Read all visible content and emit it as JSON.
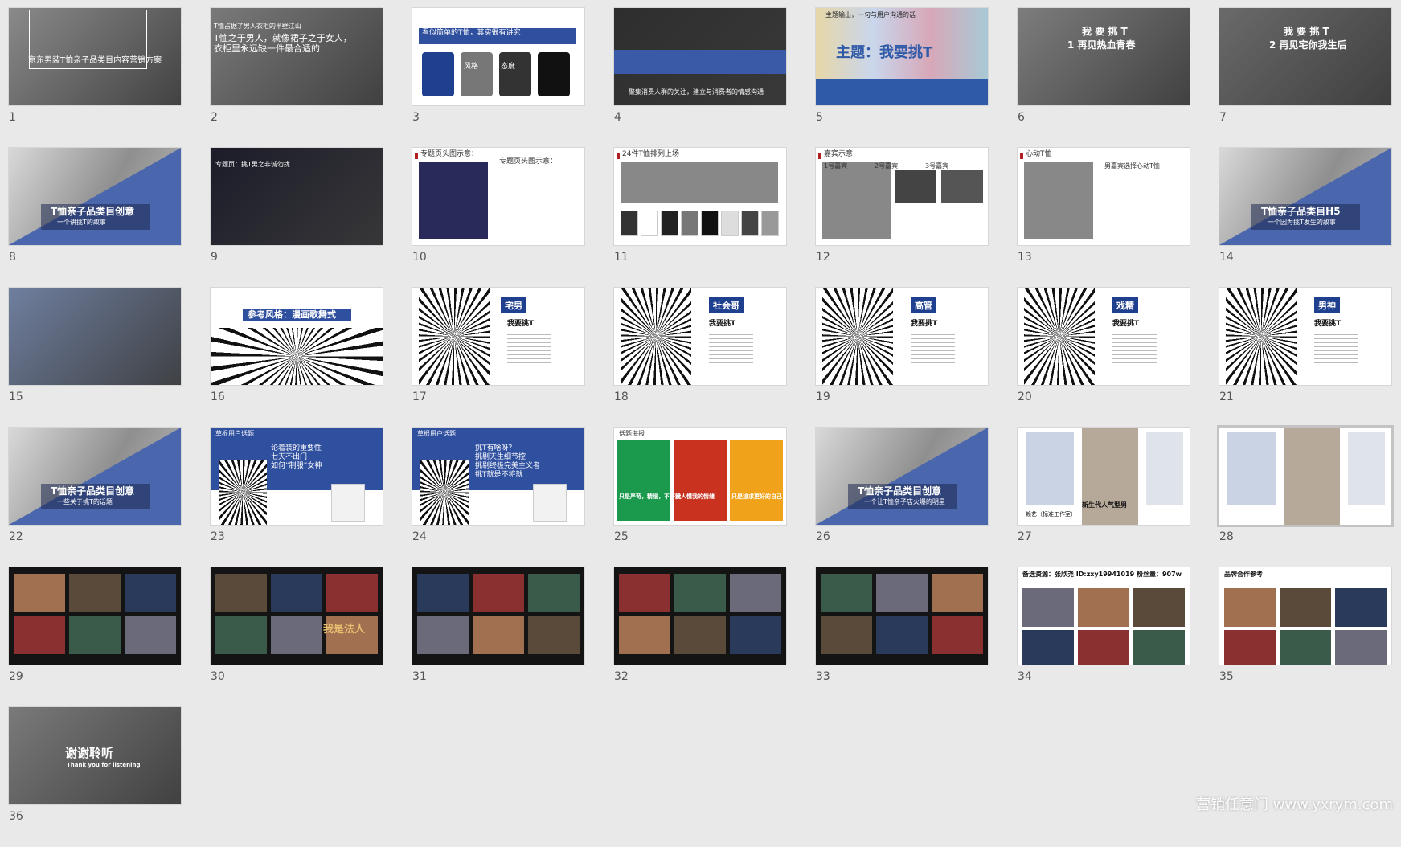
{
  "watermark": "营销任意门 www.yxrym.com",
  "slides": [
    {
      "num": "1",
      "lines": [
        "京东男装T恤亲子品类目内容营销方案"
      ],
      "bg": "#8a8a8a",
      "fg": "#ffffff"
    },
    {
      "num": "2",
      "lines": [
        "T恤占据了男人衣柜的半壁江山",
        "T恤之于男人，就像裙子之于女人，",
        "衣柜里永远缺一件最合适的"
      ],
      "bg": "#7a7a7a",
      "fg": "#ffffff"
    },
    {
      "num": "3",
      "lines": [
        "看似简单的T恤，其实很有讲究",
        "风格",
        "态度"
      ],
      "bg": "#ffffff",
      "fg": "#ffffff"
    },
    {
      "num": "4",
      "lines": [
        "聚集消费人群的关注，建立与消费者的情感沟通"
      ],
      "bg": "#2e2e2e",
      "fg": "#ffffff"
    },
    {
      "num": "5",
      "lines": [
        "主题输出，一句与用户沟通的话",
        "主题：我要挑T"
      ],
      "bg": "#ffffff",
      "fg": "#1f4fa8"
    },
    {
      "num": "6",
      "lines": [
        "我 要 挑 T",
        "1 再见热血青春"
      ],
      "bg": "#7d7d7d",
      "fg": "#ffffff"
    },
    {
      "num": "7",
      "lines": [
        "我 要 挑 T",
        "2 再见宅你我生后"
      ],
      "bg": "#6a6a6a",
      "fg": "#ffffff"
    },
    {
      "num": "8",
      "lines": [
        "T恤亲子品类目创意",
        "一个讲挑T的故事"
      ],
      "bg": "#5470b4",
      "fg": "#ffffff"
    },
    {
      "num": "9",
      "lines": [
        "专题页：挑T男之非诚勿扰"
      ],
      "bg": "#1c1c2a",
      "fg": "#ffffff"
    },
    {
      "num": "10",
      "lines": [
        "专题页头图示意："
      ],
      "bg": "#ffffff",
      "fg": "#333333"
    },
    {
      "num": "11",
      "lines": [
        "24件T恤排列上场"
      ],
      "bg": "#ffffff",
      "fg": "#333333"
    },
    {
      "num": "12",
      "lines": [
        "嘉宾示意",
        "1号嘉宾",
        "2号嘉宾",
        "3号嘉宾"
      ],
      "bg": "#ffffff",
      "fg": "#333333"
    },
    {
      "num": "13",
      "lines": [
        "心动T恤",
        "男嘉宾选择心动T恤"
      ],
      "bg": "#ffffff",
      "fg": "#333333"
    },
    {
      "num": "14",
      "lines": [
        "T恤亲子品类目H5",
        "一个因为挑T发生的故事"
      ],
      "bg": "#5470b4",
      "fg": "#ffffff"
    },
    {
      "num": "15",
      "lines": [],
      "bg": "#6f7f9f",
      "fg": "#ffffff"
    },
    {
      "num": "16",
      "lines": [
        "参考风格：漫画歌舞式"
      ],
      "bg": "#ffffff",
      "fg": "#ffffff"
    },
    {
      "num": "17",
      "lines": [
        "宅男",
        "我要挑T"
      ],
      "bg": "#ffffff",
      "fg": "#ffffff"
    },
    {
      "num": "18",
      "lines": [
        "社会哥",
        "我要挑T"
      ],
      "bg": "#ffffff",
      "fg": "#ffffff"
    },
    {
      "num": "19",
      "lines": [
        "高管",
        "我要挑T"
      ],
      "bg": "#ffffff",
      "fg": "#ffffff"
    },
    {
      "num": "20",
      "lines": [
        "戏精",
        "我要挑T"
      ],
      "bg": "#ffffff",
      "fg": "#ffffff"
    },
    {
      "num": "21",
      "lines": [
        "男神",
        "我要挑T"
      ],
      "bg": "#ffffff",
      "fg": "#ffffff"
    },
    {
      "num": "22",
      "lines": [
        "T恤亲子品类目创意",
        "一些关于挑T的话题"
      ],
      "bg": "#5470b4",
      "fg": "#ffffff"
    },
    {
      "num": "23",
      "lines": [
        "草根用户话题",
        "论着装的重要性",
        "七天不出门",
        "如何“制服”女神"
      ],
      "bg": "#2f4f9f",
      "fg": "#ffffff"
    },
    {
      "num": "24",
      "lines": [
        "草根用户话题",
        "挑T有啥呀？",
        "挑剔天生细节控",
        "挑剔终极完美主义者",
        "挑T就是不将就"
      ],
      "bg": "#2f4f9f",
      "fg": "#ffffff"
    },
    {
      "num": "25",
      "lines": [
        "话题海报",
        "只是严苛，精细，不将就",
        "没人懂我的情绪",
        "只是追求更好的自己"
      ],
      "bg": "#ffffff",
      "fg": "#ffffff"
    },
    {
      "num": "26",
      "lines": [
        "T恤亲子品类目创意",
        "一个让T恤亲子店火爆的明星"
      ],
      "bg": "#5470b4",
      "fg": "#ffffff"
    },
    {
      "num": "27",
      "lines": [
        "新生代人气型男",
        "赖艺（标准工作室）"
      ],
      "bg": "#ffffff",
      "fg": "#333333"
    },
    {
      "num": "28",
      "lines": [],
      "bg": "#ffffff",
      "fg": "#333333"
    },
    {
      "num": "29",
      "lines": [],
      "bg": "#141414",
      "fg": "#ffffff"
    },
    {
      "num": "30",
      "lines": [
        "我是法人"
      ],
      "bg": "#141414",
      "fg": "#ffffff"
    },
    {
      "num": "31",
      "lines": [],
      "bg": "#141414",
      "fg": "#ffffff"
    },
    {
      "num": "32",
      "lines": [],
      "bg": "#141414",
      "fg": "#ffffff"
    },
    {
      "num": "33",
      "lines": [],
      "bg": "#141414",
      "fg": "#ffffff"
    },
    {
      "num": "34",
      "lines": [
        "备选资源：张欣尧  ID:zxy19941019  粉丝量：907w"
      ],
      "bg": "#ffffff",
      "fg": "#111111"
    },
    {
      "num": "35",
      "lines": [
        "品牌合作参考"
      ],
      "bg": "#ffffff",
      "fg": "#111111"
    },
    {
      "num": "36",
      "lines": [
        "谢谢聆听",
        "Thank you for listening"
      ],
      "bg": "#7a7a7a",
      "fg": "#ffffff"
    }
  ]
}
